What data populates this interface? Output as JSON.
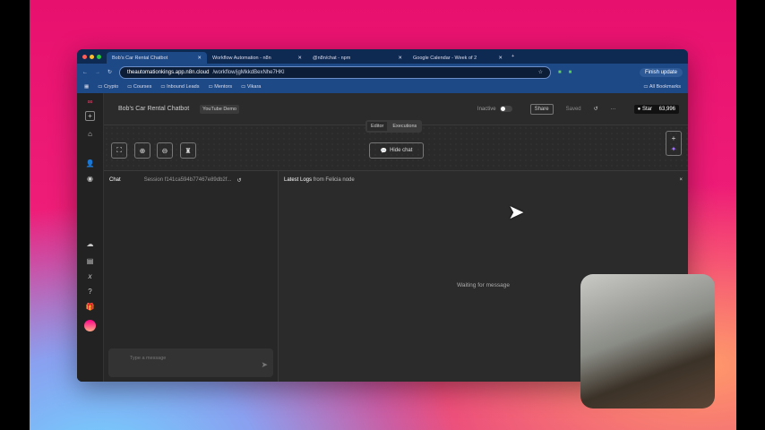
{
  "browser": {
    "tabs": [
      {
        "label": "Bob's Car Rental Chatbot",
        "active": true
      },
      {
        "label": "Workflow Automation - n8n"
      },
      {
        "label": "@n8n/chat - npm"
      },
      {
        "label": "Google Calendar - Week of 2"
      }
    ],
    "url_host": "theautomationkings.app.n8n.cloud",
    "url_path": "/workflow/jgMkkdBexNhe7HKl",
    "finish_update": "Finish update",
    "bookmarks": [
      "Crypto",
      "Courses",
      "Inbound Leads",
      "Mentors",
      "Vikara"
    ],
    "all_bookmarks": "All Bookmarks"
  },
  "app": {
    "workflow_name": "Bob's Car Rental Chatbot",
    "tag": "YouTube Demo",
    "status": "Inactive",
    "share": "Share",
    "saved": "Saved",
    "star": "Star",
    "star_count": "63,996",
    "tabs": [
      "Editor",
      "Executions"
    ],
    "hide_chat": "Hide chat"
  },
  "chat": {
    "title": "Chat",
    "session": "Session  f141ca594b77467e89db2f...",
    "placeholder": "Type a message"
  },
  "logs": {
    "title": "Latest Logs",
    "subtitle": "from Felicia node",
    "waiting": "Waiting for message",
    "close": "×"
  }
}
